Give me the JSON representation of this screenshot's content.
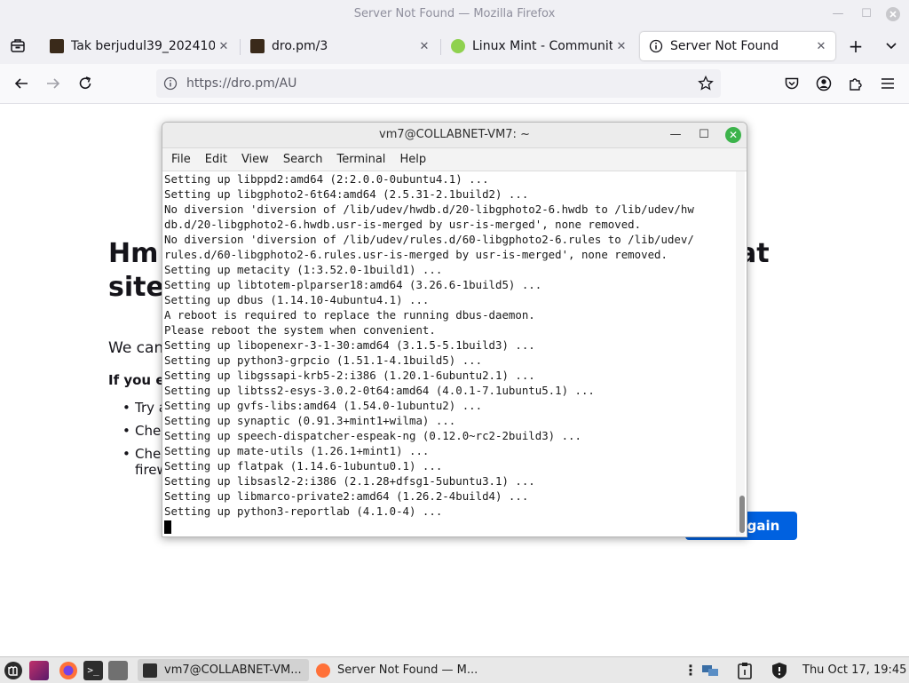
{
  "window": {
    "title": "Server Not Found — Mozilla Firefox"
  },
  "tabs": [
    {
      "label": "Tak berjudul39_2024101",
      "active": false
    },
    {
      "label": "dro.pm/3",
      "active": false
    },
    {
      "label": "Linux Mint - Community",
      "active": false
    },
    {
      "label": "Server Not Found",
      "active": true
    }
  ],
  "navbar": {
    "url": "https://dro.pm/AU"
  },
  "error_page": {
    "title_left_1": "Hm",
    "title_right_1": "at",
    "title_left_2": "site",
    "subtitle": "We can",
    "if_you": "If you e",
    "items": [
      "Try a",
      "Chec",
      "Chec"
    ],
    "item3_line2": "firew",
    "try_again": "gain"
  },
  "terminal": {
    "title": "vm7@COLLABNET-VM7: ~",
    "menu": [
      "File",
      "Edit",
      "View",
      "Search",
      "Terminal",
      "Help"
    ],
    "lines": [
      "Setting up libppd2:amd64 (2:2.0.0-0ubuntu4.1) ...",
      "Setting up libgphoto2-6t64:amd64 (2.5.31-2.1build2) ...",
      "No diversion 'diversion of /lib/udev/hwdb.d/20-libgphoto2-6.hwdb to /lib/udev/hw",
      "db.d/20-libgphoto2-6.hwdb.usr-is-merged by usr-is-merged', none removed.",
      "No diversion 'diversion of /lib/udev/rules.d/60-libgphoto2-6.rules to /lib/udev/",
      "rules.d/60-libgphoto2-6.rules.usr-is-merged by usr-is-merged', none removed.",
      "Setting up metacity (1:3.52.0-1build1) ...",
      "Setting up libtotem-plparser18:amd64 (3.26.6-1build5) ...",
      "Setting up dbus (1.14.10-4ubuntu4.1) ...",
      "A reboot is required to replace the running dbus-daemon.",
      "Please reboot the system when convenient.",
      "Setting up libopenexr-3-1-30:amd64 (3.1.5-5.1build3) ...",
      "Setting up python3-grpcio (1.51.1-4.1build5) ...",
      "Setting up libgssapi-krb5-2:i386 (1.20.1-6ubuntu2.1) ...",
      "Setting up libtss2-esys-3.0.2-0t64:amd64 (4.0.1-7.1ubuntu5.1) ...",
      "Setting up gvfs-libs:amd64 (1.54.0-1ubuntu2) ...",
      "Setting up synaptic (0.91.3+mint1+wilma) ...",
      "Setting up speech-dispatcher-espeak-ng (0.12.0~rc2-2build3) ...",
      "Setting up mate-utils (1.26.1+mint1) ...",
      "Setting up flatpak (1.14.6-1ubuntu0.1) ...",
      "Setting up libsasl2-2:i386 (2.1.28+dfsg1-5ubuntu3.1) ...",
      "Setting up libmarco-private2:amd64 (1.26.2-4build4) ...",
      "Setting up python3-reportlab (4.1.0-4) ..."
    ]
  },
  "taskbar": {
    "tasks": [
      {
        "label": "vm7@COLLABNET-VM...",
        "active": true
      },
      {
        "label": "Server Not Found — M...",
        "active": false
      }
    ],
    "clock": "Thu Oct 17, 19:45"
  },
  "colors": {
    "accent": "#0061e0",
    "mint_green": "#3cb34b"
  }
}
